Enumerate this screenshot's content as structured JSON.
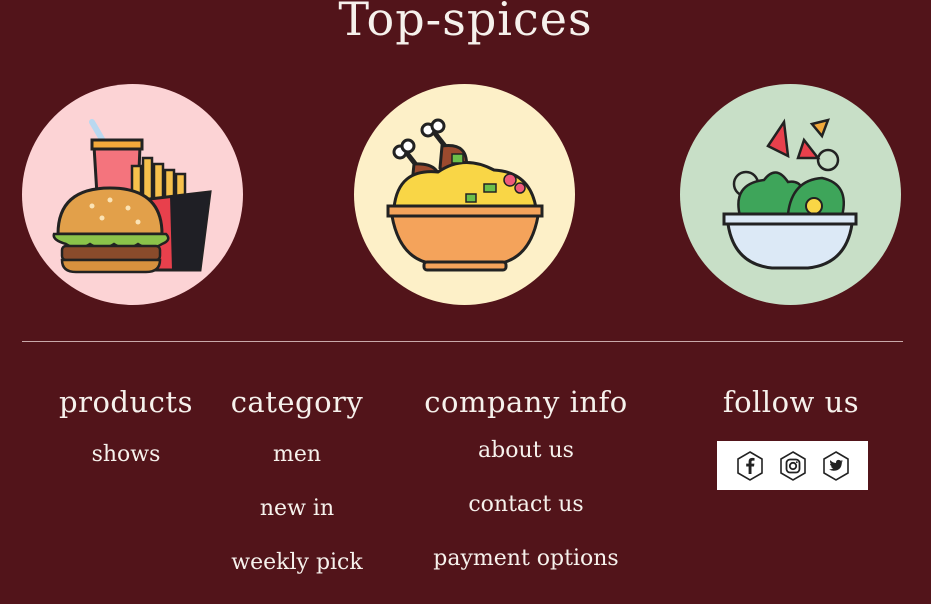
{
  "header": {
    "title": "Top-spices"
  },
  "featured": [
    {
      "icon": "burger-fries-soda-icon",
      "bg": "#fcd3d5"
    },
    {
      "icon": "chicken-rice-bowl-icon",
      "bg": "#fdf0c8"
    },
    {
      "icon": "salad-bowl-icon",
      "bg": "#c8dfc7"
    }
  ],
  "footer": {
    "products": {
      "heading": "products",
      "links": [
        "shows"
      ]
    },
    "category": {
      "heading": "category",
      "links": [
        "men",
        "new in",
        "weekly pick"
      ]
    },
    "company": {
      "heading": "company info",
      "links": [
        "about us",
        "contact us",
        "payment options"
      ]
    },
    "follow": {
      "heading": "follow us",
      "icons": [
        "facebook-icon",
        "instagram-icon",
        "twitter-icon"
      ]
    }
  },
  "colors": {
    "background": "#52141a",
    "text": "#f6f1ec",
    "divider": "#c9a9aa"
  }
}
